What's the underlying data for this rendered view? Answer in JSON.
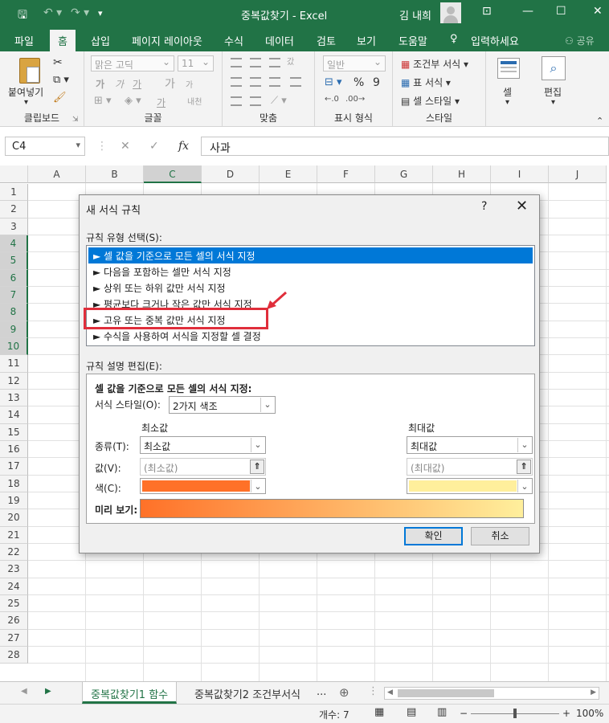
{
  "titlebar": {
    "title": "중복값찾기 - Excel",
    "user": "김 내희",
    "qa_icons": [
      "save-icon",
      "undo-icon",
      "redo-icon",
      "customize-icon"
    ],
    "window_icons": [
      "ribbon-display-icon",
      "minimize-icon",
      "maximize-icon",
      "close-icon"
    ]
  },
  "tabs": {
    "items": [
      "파일",
      "홈",
      "삽입",
      "페이지 레이아웃",
      "수식",
      "데이터",
      "검토",
      "보기",
      "도움말",
      "입력하세요"
    ],
    "active": "홈",
    "share": "공유"
  },
  "ribbon": {
    "clipboard": {
      "label": "클립보드",
      "paste": "붙여넣기"
    },
    "font": {
      "label": "글꼴",
      "font_name": "맑은 고딕",
      "font_size": "11",
      "bold": "가",
      "italic": "가",
      "underline": "가",
      "grow": "가",
      "shrink": "가",
      "font_color": "가",
      "phonetic": "내천"
    },
    "align": {
      "label": "맞춤",
      "wrap": "갔"
    },
    "number": {
      "label": "표시 형식",
      "format": "일반",
      "percent": "%",
      "comma": "9"
    },
    "styles": {
      "label": "스타일",
      "conditional": "조건부 서식",
      "table": "표 서식",
      "cell_style": "셀 스타일"
    },
    "cells": {
      "label": "셀"
    },
    "edit": {
      "label": "편집"
    }
  },
  "formula_bar": {
    "name_box": "C4",
    "formula": "사과",
    "cancel": "✕",
    "enter": "✓",
    "fx": "fx"
  },
  "grid": {
    "columns": [
      "A",
      "B",
      "C",
      "D",
      "E",
      "F",
      "G",
      "H",
      "I",
      "J"
    ],
    "selected_column": "C",
    "rows": [
      "1",
      "2",
      "3",
      "4",
      "5",
      "6",
      "7",
      "8",
      "9",
      "10",
      "11",
      "12",
      "13",
      "14",
      "15",
      "16",
      "17",
      "18",
      "19",
      "20",
      "21",
      "22",
      "23",
      "24",
      "25",
      "26",
      "27",
      "28"
    ],
    "selected_rows": [
      "4",
      "5",
      "6",
      "7",
      "8",
      "9",
      "10"
    ]
  },
  "sheets": {
    "tabs": [
      "중복값찾기1 함수",
      "중복값찾기2 조건부서식"
    ],
    "more": "...",
    "add": "⊕"
  },
  "status": {
    "count": "개수: 7",
    "zoom": "100%",
    "minus": "−",
    "plus": "+"
  },
  "dialog": {
    "title": "새 서식 규칙",
    "help": "?",
    "close": "✕",
    "select_type_label": "규칙 유형 선택(S):",
    "types": [
      "► 셀 값을 기준으로 모든 셀의 서식 지정",
      "► 다음을 포함하는 셀만 서식 지정",
      "► 상위 또는 하위 값만 서식 지정",
      "► 평균보다 크거나 작은 값만 서식 지정",
      "► 고유 또는 중복 값만 서식 지정",
      "► 수식을 사용하여 서식을 지정할 셀 결정"
    ],
    "selected_type_index": 0,
    "highlighted_type_index": 4,
    "edit_label": "규칙 설명 편집(E):",
    "desc_title": "셀 값을 기준으로 모든 셀의 서식 지정:",
    "style_label": "서식 스타일(O):",
    "style_value": "2가지 색조",
    "min_header": "최소값",
    "max_header": "최대값",
    "type_label": "종류(T):",
    "value_label": "값(V):",
    "color_label": "색(C):",
    "min_type": "최소값",
    "max_type": "최대값",
    "min_value_placeholder": "(최소값)",
    "max_value_placeholder": "(최대값)",
    "min_color": "#ff7128",
    "max_color": "#ffef9c",
    "preview_label": "미리 보기:",
    "ok": "확인",
    "cancel": "취소"
  },
  "colors": {
    "excel_green": "#217346",
    "selection_blue": "#0078d7",
    "highlight_red": "#e02e3b"
  }
}
